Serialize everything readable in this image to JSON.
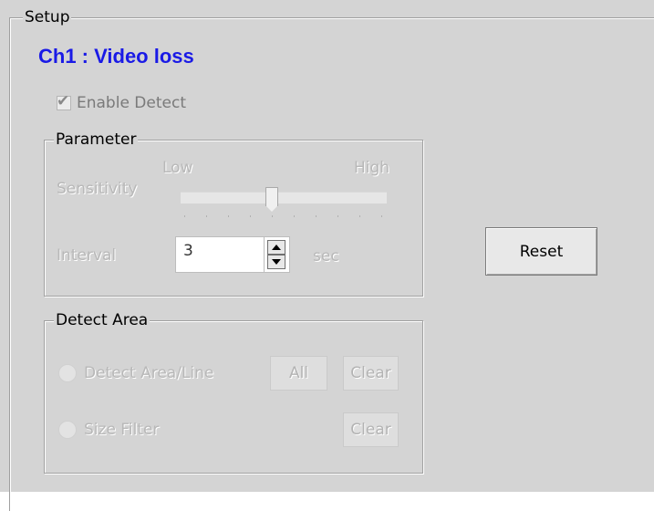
{
  "setup": {
    "title": "Setup"
  },
  "channel": {
    "title": "Ch1 : Video loss"
  },
  "enable_detect": {
    "label": "Enable Detect",
    "checked": true
  },
  "parameter": {
    "title": "Parameter",
    "sensitivity": {
      "label": "Sensitivity",
      "low_label": "Low",
      "high_label": "High"
    },
    "interval": {
      "label": "Interval",
      "value": "3",
      "unit": "sec"
    }
  },
  "reset_button": {
    "label": "Reset"
  },
  "detect_area": {
    "title": "Detect Area",
    "area_line": {
      "label": "Detect Area/Line",
      "all_label": "All",
      "clear_label": "Clear"
    },
    "size_filter": {
      "label": "Size Filter",
      "clear_label": "Clear"
    }
  },
  "colors": {
    "title_blue": "#1a1ae6",
    "panel_bg": "#d4d4d4",
    "disabled_text": "#b8b8b8"
  }
}
